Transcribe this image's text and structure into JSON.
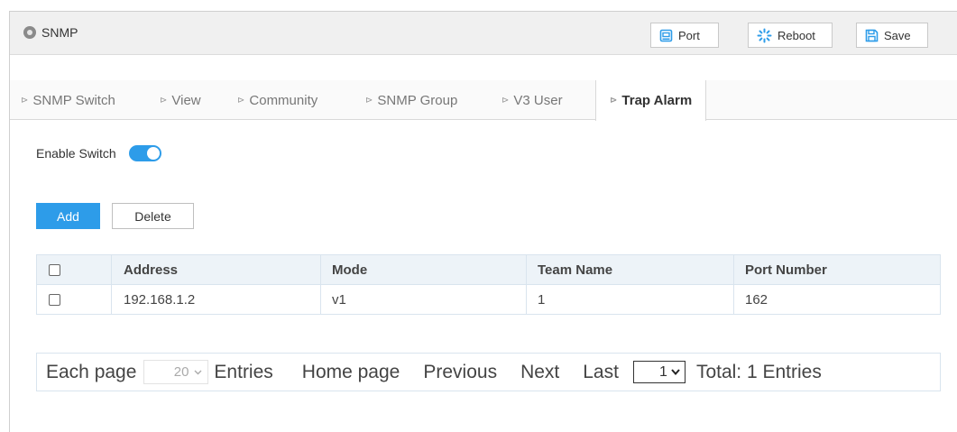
{
  "header": {
    "title": "SNMP",
    "port_label": "Port",
    "reboot_label": "Reboot",
    "save_label": "Save"
  },
  "tabs": [
    {
      "label": "SNMP Switch",
      "active": false
    },
    {
      "label": "View",
      "active": false
    },
    {
      "label": "Community",
      "active": false
    },
    {
      "label": "SNMP Group",
      "active": false
    },
    {
      "label": "V3 User",
      "active": false
    },
    {
      "label": "Trap Alarm",
      "active": true
    }
  ],
  "enable_switch": {
    "label": "Enable Switch",
    "on": true
  },
  "buttons": {
    "add": "Add",
    "delete": "Delete"
  },
  "table": {
    "columns": [
      "Address",
      "Mode",
      "Team Name",
      "Port Number"
    ],
    "rows": [
      {
        "address": "192.168.1.2",
        "mode": "v1",
        "team_name": "1",
        "port_number": "162",
        "checked": false
      }
    ]
  },
  "pager": {
    "each_page": "Each page",
    "page_size": "20",
    "entries": "Entries",
    "home": "Home page",
    "previous": "Previous",
    "next": "Next",
    "last": "Last",
    "current_page": "1",
    "total": "Total: 1 Entries"
  },
  "colors": {
    "accent": "#2d9ce9"
  },
  "icons": {
    "title": "settings-dot-icon",
    "port": "port-icon",
    "reboot": "reboot-icon",
    "save": "save-icon",
    "tab_chevron": "chevron-right-icon"
  }
}
